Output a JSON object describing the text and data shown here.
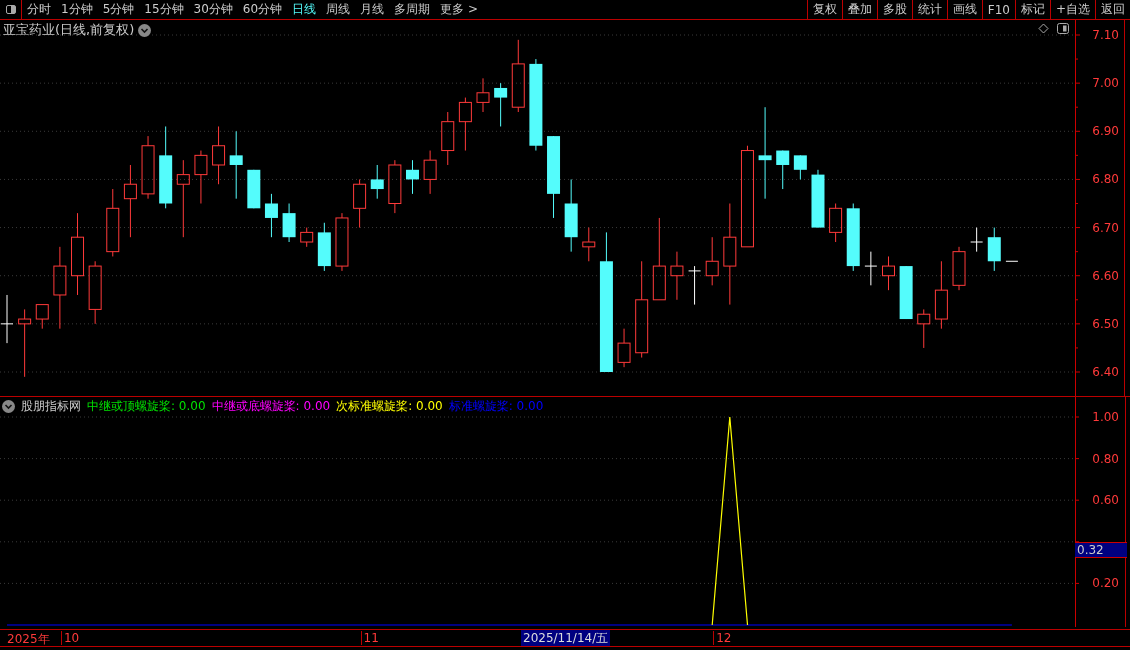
{
  "toolbar": {
    "periods": [
      {
        "label": "分时",
        "selected": false
      },
      {
        "label": "1分钟",
        "selected": false
      },
      {
        "label": "5分钟",
        "selected": false
      },
      {
        "label": "15分钟",
        "selected": false
      },
      {
        "label": "30分钟",
        "selected": false
      },
      {
        "label": "60分钟",
        "selected": false
      },
      {
        "label": "日线",
        "selected": true
      },
      {
        "label": "周线",
        "selected": false
      },
      {
        "label": "月线",
        "selected": false
      },
      {
        "label": "多周期",
        "selected": false
      }
    ],
    "more": "更多 >",
    "buttons": [
      "复权",
      "叠加",
      "多股",
      "统计",
      "画线",
      "F10",
      "标记",
      "+自选",
      "返回"
    ]
  },
  "main_chart": {
    "title": "亚宝药业(日线,前复权)",
    "price_labels": [
      "7.10",
      "7.00",
      "6.90",
      "6.80",
      "6.70",
      "6.60",
      "6.50",
      "6.40"
    ]
  },
  "indicator": {
    "name": "股朋指标网",
    "legend": [
      {
        "label": "中继或顶螺旋桨:",
        "value": "0.00",
        "color": "#00e000"
      },
      {
        "label": "中继或底螺旋桨:",
        "value": "0.00",
        "color": "#ff00ff"
      },
      {
        "label": "次标准螺旋桨:",
        "value": "0.00",
        "color": "#ffff00"
      },
      {
        "label": "标准螺旋桨:",
        "value": "0.00",
        "color": "#0000ff"
      }
    ],
    "chart_data": {
      "type": "line",
      "ylim": [
        0,
        1
      ],
      "grid": true,
      "yticks": [
        {
          "value": 0.2,
          "label": "0.20"
        },
        {
          "value": 0.6,
          "label": "0.60"
        },
        {
          "value": 0.8,
          "label": "0.80"
        },
        {
          "value": 1,
          "label": "1.00"
        }
      ],
      "series": [
        {
          "color": "#0000ff",
          "values": [
            0,
            0,
            0,
            0,
            0,
            0,
            0,
            0,
            0,
            0,
            0,
            0,
            0,
            0,
            0,
            0,
            0,
            0,
            0,
            0,
            0,
            0,
            0,
            0,
            0,
            0,
            0,
            0,
            0,
            0,
            0,
            0,
            0,
            0,
            0,
            0,
            0,
            0,
            0,
            0,
            0,
            0,
            0,
            0,
            0,
            0,
            0,
            0,
            0,
            0,
            0,
            0,
            0,
            0,
            0,
            0,
            0,
            0
          ]
        },
        {
          "color": "#ffff00",
          "values": [
            null,
            null,
            null,
            null,
            null,
            null,
            null,
            null,
            null,
            null,
            null,
            null,
            null,
            null,
            null,
            null,
            null,
            null,
            null,
            null,
            null,
            null,
            null,
            null,
            null,
            null,
            null,
            null,
            null,
            null,
            null,
            null,
            null,
            null,
            null,
            null,
            null,
            null,
            null,
            null,
            0,
            1,
            0,
            null,
            null,
            null,
            null,
            null,
            null,
            null,
            null,
            null,
            null,
            null,
            null,
            null,
            null,
            null
          ]
        }
      ]
    },
    "cursor_value": "0.32"
  },
  "time_axis": {
    "year": "2025年",
    "months": [
      "10",
      "11",
      "12"
    ],
    "cursor_date": "2025/11/14/五"
  }
}
